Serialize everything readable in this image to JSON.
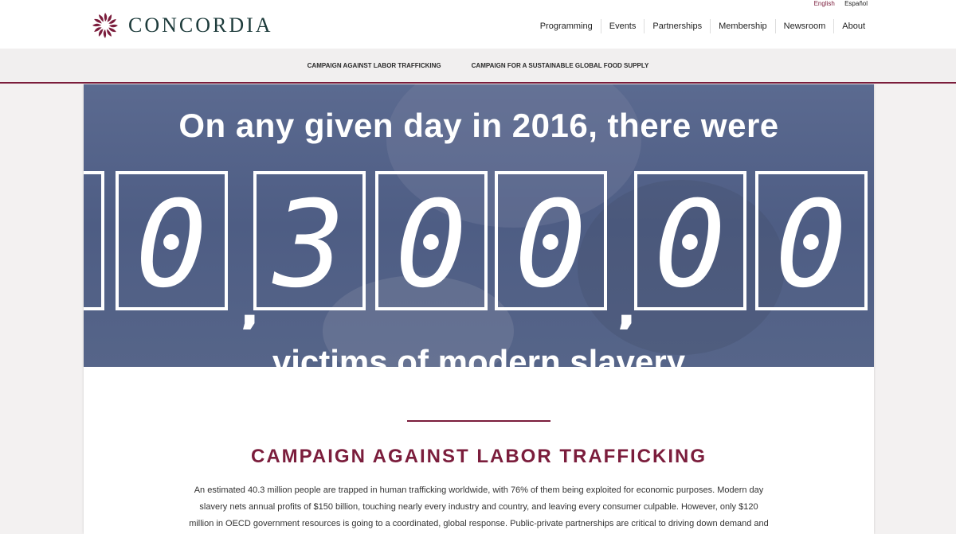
{
  "language": {
    "english": "English",
    "spanish": "Español"
  },
  "brand": {
    "name": "CONCORDIA",
    "accent": "#7b1d3c",
    "wordmark_color": "#1d3b3b"
  },
  "nav": [
    "Programming",
    "Events",
    "Partnerships",
    "Membership",
    "Newsroom",
    "About"
  ],
  "subnav": [
    "CAMPAIGN AGAINST LABOR TRAFFICKING",
    "CAMPAIGN FOR A SUSTAINABLE GLOBAL FOOD SUPPLY"
  ],
  "hero": {
    "headline": "On any given day in 2016, there were",
    "digits": [
      "0",
      "3",
      "0",
      "0",
      "0",
      "0"
    ],
    "footline": "victims of modern slavery"
  },
  "section": {
    "title": "CAMPAIGN AGAINST LABOR TRAFFICKING",
    "body": "An estimated 40.3 million people are trapped in human trafficking worldwide, with 76% of them being exploited for economic purposes. Modern day slavery nets annual profits of $150 billion, touching nearly every industry and country, and leaving every consumer culpable. However, only $120 million in OECD government resources is going to a coordinated, global response. Public-private partnerships are critical to driving down demand and"
  }
}
